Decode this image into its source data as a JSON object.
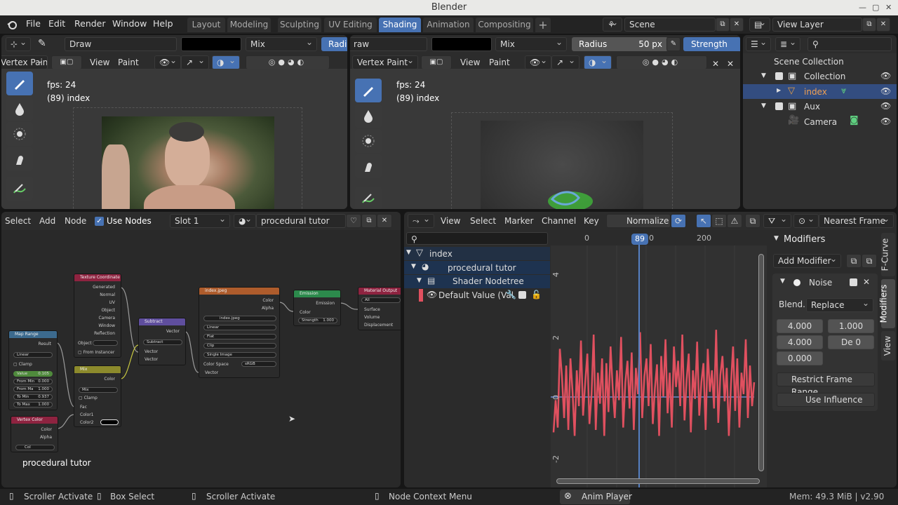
{
  "window": {
    "title": "Blender"
  },
  "menu": [
    "File",
    "Edit",
    "Render",
    "Window",
    "Help"
  ],
  "workspaces": [
    {
      "label": "Layout"
    },
    {
      "label": "Modeling"
    },
    {
      "label": "Sculpting"
    },
    {
      "label": "UV Editing"
    },
    {
      "label": "Shading",
      "active": true
    },
    {
      "label": "Animation"
    },
    {
      "label": "Compositing"
    }
  ],
  "scene": "Scene",
  "view_layer": "View Layer",
  "viewport_left": {
    "brush": "Draw",
    "blend": "Mix",
    "radius_label": "Radiu",
    "mode": "Vertex Paint",
    "menus": [
      "View",
      "Paint"
    ],
    "fps": "fps: 24",
    "object": "(89) index"
  },
  "viewport_right": {
    "brush": "raw",
    "blend": "Mix",
    "radius_label": "Radius",
    "radius_value": "50 px",
    "strength_label": "Strength",
    "mode": "Vertex Paint",
    "menus": [
      "View",
      "Paint"
    ],
    "fps": "fps: 24",
    "object": "(89) index"
  },
  "outliner": {
    "items": [
      {
        "label": "Scene Collection"
      },
      {
        "label": "Collection"
      },
      {
        "label": "index",
        "selected": true
      },
      {
        "label": "Aux"
      },
      {
        "label": "Camera"
      }
    ]
  },
  "node_editor": {
    "menus": [
      "Select",
      "Add",
      "Node"
    ],
    "use_nodes": "Use Nodes",
    "slot": "Slot 1",
    "material": "procedural tutor",
    "label": "procedural tutor",
    "nodes": {
      "tex_coord": {
        "title": "Texture Coordinate",
        "outputs": [
          "Generated",
          "Normal",
          "UV",
          "Object",
          "Camera",
          "Window",
          "Reflection"
        ],
        "object_label": "Object",
        "from_instancer": "From Instancer"
      },
      "map_range": {
        "title": "Map Range",
        "result": "Result",
        "type": "Linear",
        "clamp": "Clamp",
        "value": "Value",
        "value_v": "0.105",
        "from_min": "From Min",
        "from_min_v": "0.000",
        "from_max": "From Ma",
        "from_max_v": "1.000",
        "to_min": "To Min",
        "to_min_v": "0.937",
        "to_max": "To Max",
        "to_max_v": "1.000"
      },
      "mix": {
        "title": "Mix",
        "color": "Color",
        "blend": "Mix",
        "clamp": "Clamp",
        "fac": "Fac",
        "color1": "Color1",
        "color2": "Color2"
      },
      "vertex_color": {
        "title": "Vertex Color",
        "color": "Color",
        "alpha": "Alpha",
        "layer": "Col"
      },
      "subtract": {
        "title": "Subtract",
        "vector": "Vector",
        "op": "Subtract",
        "in1": "Vector",
        "in2": "Vector"
      },
      "image": {
        "title": "index.jpeg",
        "color": "Color",
        "alpha": "Alpha",
        "file": "index.jpeg",
        "interp": "Linear",
        "proj": "Flat",
        "ext": "Clip",
        "source": "Single Image",
        "cs_label": "Color Space",
        "cs": "sRGB",
        "vector": "Vector"
      },
      "emission": {
        "title": "Emission",
        "out": "Emission",
        "color": "Color",
        "strength": "Strength",
        "strength_v": "1.000"
      },
      "output": {
        "title": "Material Output",
        "target": "All",
        "surface": "Surface",
        "volume": "Volume",
        "displacement": "Displacement"
      }
    }
  },
  "graph_editor": {
    "menus": [
      "View",
      "Select",
      "Marker",
      "Channel",
      "Key"
    ],
    "normalize": "Normalize",
    "interp": "Nearest Frame",
    "frame": "89",
    "frame_suffix": "0",
    "ruler": [
      "0",
      "200"
    ],
    "yticks": [
      "4",
      "2",
      "0",
      "-2"
    ],
    "channels": [
      {
        "label": "index"
      },
      {
        "label": "procedural tutor"
      },
      {
        "label": "Shader Nodetree"
      },
      {
        "label": "Default Value (Val"
      }
    ],
    "curve": [
      0.08,
      0.35,
      0.12,
      0.78,
      0.55,
      0.2,
      0.64,
      0.1,
      0.7,
      0.42,
      0.05,
      0.6,
      0.3,
      0.85,
      0.22,
      0.5,
      0.74,
      0.15,
      0.4,
      0.9,
      0.1,
      0.58,
      0.32,
      0.7,
      0.05,
      0.66,
      0.25,
      0.8,
      0.45,
      0.2,
      0.6,
      0.35,
      0.88,
      0.12,
      0.5,
      0.68,
      0.28,
      0.75,
      0.1,
      0.62,
      0.4,
      0.92,
      0.2,
      0.55,
      0.7,
      0.3,
      0.82,
      0.15,
      0.45,
      0.65,
      0.05,
      0.72,
      0.38,
      0.86,
      0.24,
      0.58,
      0.12,
      0.8,
      0.46,
      0.68,
      0.3,
      0.9,
      0.18,
      0.52,
      0.74,
      0.08,
      0.6,
      0.36,
      0.84,
      0.22,
      0.5,
      0.66,
      0.1,
      0.78,
      0.42,
      0.6,
      0.28,
      0.94,
      0.16,
      0.56,
      0.72,
      0.34,
      0.62,
      0.05,
      0.48,
      0.8,
      0.26,
      0.7,
      0.12,
      0.58,
      0.4,
      0.86,
      0.2,
      0.64,
      0.3,
      0.5
    ]
  },
  "modifiers_panel": {
    "title": "Modifiers",
    "add": "Add Modifier",
    "noise": "Noise",
    "blend_label": "Blend...",
    "blend": "Replace",
    "v1": "4.000",
    "v2": "1.000",
    "v3": "4.000",
    "de_label": "De",
    "de_value": "0",
    "v5": "0.000",
    "restrict": "Restrict Frame Range",
    "influence": "Use Influence",
    "tabs": [
      "F-Curve",
      "Modifiers",
      "View"
    ]
  },
  "status": [
    {
      "label": "Scroller Activate"
    },
    {
      "label": "Box Select"
    },
    {
      "label": "Scroller Activate"
    },
    {
      "label": "Node Context Menu"
    },
    {
      "label": "Anim Player"
    }
  ],
  "memory": "Mem: 49.3 MiB | v2.90",
  "colors": {
    "accent": "#4772b3",
    "curve": "#e0505f",
    "frame_line": "#5680c2"
  }
}
